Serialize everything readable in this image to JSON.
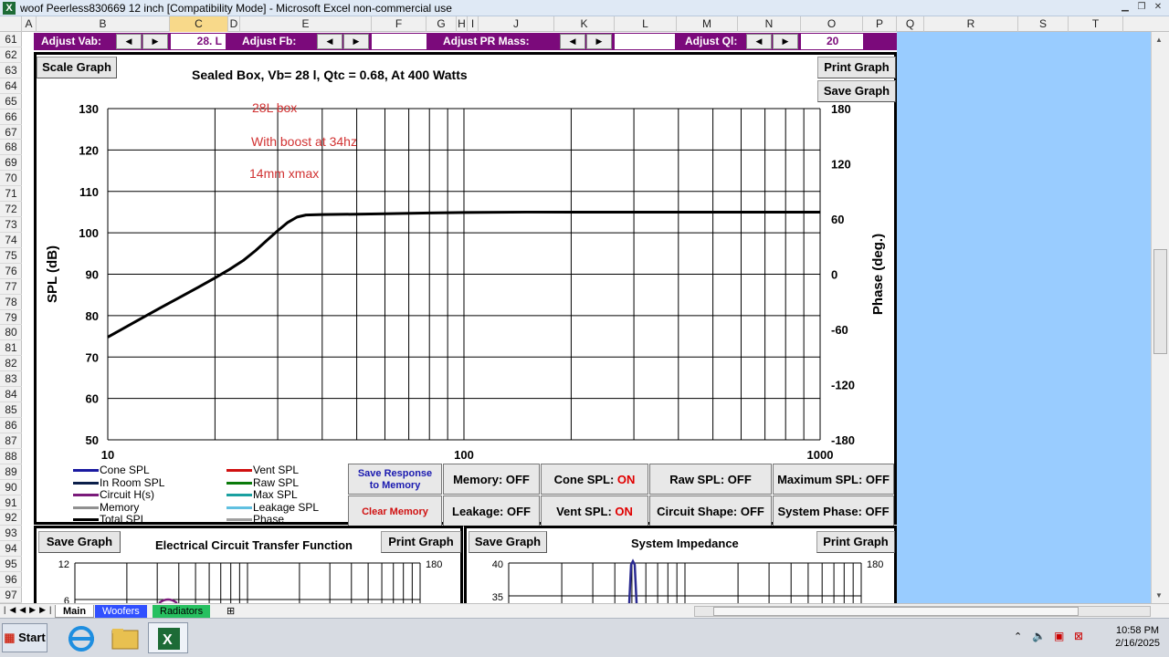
{
  "window": {
    "title": "woof Peerless830669 12 inch  [Compatibility Mode] - Microsoft Excel non-commercial use"
  },
  "columns": [
    "A",
    "B",
    "C",
    "D",
    "E",
    "F",
    "G",
    "H",
    "I",
    "J",
    "K",
    "L",
    "M",
    "N",
    "O",
    "P",
    "Q",
    "R",
    "S",
    "T"
  ],
  "selected_column": "C",
  "rows": [
    "61",
    "62",
    "63",
    "64",
    "65",
    "66",
    "67",
    "68",
    "69",
    "70",
    "71",
    "72",
    "73",
    "74",
    "75",
    "76",
    "77",
    "78",
    "79",
    "80",
    "81",
    "82",
    "83",
    "84",
    "85",
    "86",
    "87",
    "88",
    "89",
    "90",
    "91",
    "92",
    "93",
    "94",
    "95",
    "96",
    "97"
  ],
  "adjust_bar": {
    "vab_label": "Adjust Vab:",
    "vab_value": "28. L",
    "fb_label": "Adjust Fb:",
    "fb_value": "",
    "pr_label": "Adjust PR Mass:",
    "pr_value": "",
    "ql_label": "Adjust Ql:",
    "ql_value": "20",
    "left_arrow": "◀",
    "right_arrow": "▶"
  },
  "main_graph": {
    "scale_button": "Scale Graph",
    "print_button": "Print Graph",
    "save_button": "Save Graph",
    "title": "Sealed Box, Vb= 28 l,  Qtc = 0.68,  At 400 Watts",
    "annotations": [
      "28L box",
      "With boost at 34hz",
      "14mm xmax"
    ]
  },
  "chart_data": {
    "type": "line",
    "title": "Sealed Box, Vb= 28 l,  Qtc = 0.68,  At 400 Watts",
    "xlabel": "",
    "ylabel": "SPL (dB)",
    "y2label": "Phase (deg.)",
    "xscale": "log",
    "xlim": [
      10,
      1000
    ],
    "ylim": [
      50,
      130
    ],
    "y2lim": [
      -180,
      180
    ],
    "x_ticks": [
      "10",
      "100",
      "1000"
    ],
    "y_ticks": [
      "130",
      "120",
      "110",
      "100",
      "90",
      "80",
      "70",
      "60",
      "50"
    ],
    "y2_ticks": [
      "180",
      "120",
      "60",
      "0",
      "-60",
      "-120",
      "-180"
    ],
    "grid": true,
    "series": [
      {
        "name": "Total SPL",
        "color": "#000000",
        "x": [
          10,
          12,
          14,
          16,
          18,
          20,
          22,
          24,
          26,
          28,
          30,
          32,
          34,
          36,
          40,
          50,
          60,
          80,
          100,
          150,
          200,
          300,
          500,
          1000
        ],
        "y": [
          74.8,
          78.6,
          81.8,
          84.5,
          86.9,
          89.1,
          91.2,
          93.3,
          95.7,
          98.2,
          100.5,
          102.5,
          103.8,
          104.3,
          104.4,
          104.5,
          104.6,
          104.8,
          104.9,
          105.0,
          105.0,
          105.0,
          105.0,
          105.0
        ]
      }
    ]
  },
  "legend": [
    {
      "label": "Cone SPL",
      "color": "#1a1aa0"
    },
    {
      "label": "In Room SPL",
      "color": "#0b1f4a"
    },
    {
      "label": "Circuit H(s)",
      "color": "#7a1a7a"
    },
    {
      "label": "Memory",
      "color": "#909090"
    },
    {
      "label": "Total SPL",
      "color": "#000000"
    },
    {
      "label": "Vent SPL",
      "color": "#d01010"
    },
    {
      "label": "Raw SPL",
      "color": "#0a7a0a"
    },
    {
      "label": "Max SPL",
      "color": "#1aa0a0"
    },
    {
      "label": "Leakage SPL",
      "color": "#60c0e0"
    },
    {
      "label": "Phase",
      "color": "#a0a0a0"
    }
  ],
  "controls": {
    "save_response_line1": "Save Response",
    "save_response_line2": "to Memory",
    "clear_memory": "Clear Memory",
    "memory": "Memory: OFF",
    "leakage": "Leakage: OFF",
    "cone_spl_prefix": "Cone SPL: ",
    "cone_spl_state": "ON",
    "vent_spl_prefix": "Vent SPL: ",
    "vent_spl_state": "ON",
    "raw_spl": "Raw SPL: OFF",
    "circuit_shape": "Circuit Shape: OFF",
    "max_spl": "Maximum SPL: OFF",
    "system_phase": "System Phase: OFF"
  },
  "lower_left": {
    "save_button": "Save Graph",
    "title": "Electrical Circuit Transfer Function",
    "print_button": "Print Graph",
    "y_ticks": [
      "12",
      "6"
    ],
    "y2_ticks": [
      "180"
    ]
  },
  "lower_right": {
    "save_button": "Save Graph",
    "title": "System Impedance",
    "print_button": "Print Graph",
    "y_ticks": [
      "40",
      "35"
    ],
    "y2_ticks": [
      "180"
    ]
  },
  "sheet_tabs": [
    "Main",
    "Woofers",
    "Radiators"
  ],
  "active_tab": "Main",
  "taskbar": {
    "start_label": "Start",
    "time": "10:58 PM",
    "date": "2/16/2025"
  }
}
